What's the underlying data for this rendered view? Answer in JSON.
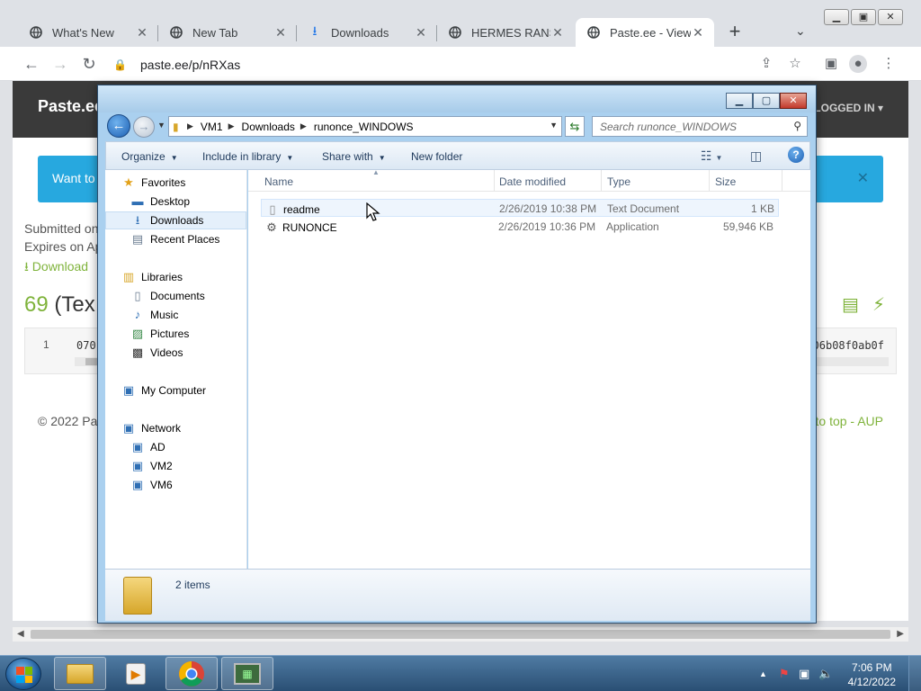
{
  "browser": {
    "tabs": [
      {
        "title": "What's New",
        "icon": "globe-icon"
      },
      {
        "title": "New Tab",
        "icon": "globe-icon"
      },
      {
        "title": "Downloads",
        "icon": "download-icon"
      },
      {
        "title": "HERMES RANSO",
        "icon": "globe-icon"
      },
      {
        "title": "Paste.ee - View p",
        "icon": "globe-icon",
        "active": true
      }
    ],
    "url": "paste.ee/p/nRXas"
  },
  "webpage": {
    "logo": "Paste.ee",
    "login": "T LOGGED IN",
    "banner": "Want to",
    "submitted": "Submitted on",
    "expires": "Expires on Ap",
    "download": "Download",
    "paste_num": "69",
    "paste_type": "(Tex",
    "code_line_no": "1",
    "code_line": "070",
    "code_tail": "706b08f0ab0f",
    "footer_left": "© 2022 Pa",
    "footer_right": "to top - AUP"
  },
  "explorer": {
    "breadcrumb": [
      "VM1",
      "Downloads",
      "runonce_WINDOWS"
    ],
    "search_placeholder": "Search runonce_WINDOWS",
    "commands": {
      "organize": "Organize",
      "include": "Include in library",
      "share": "Share with",
      "new_folder": "New folder"
    },
    "nav": {
      "favorites": "Favorites",
      "desktop": "Desktop",
      "downloads": "Downloads",
      "recent": "Recent Places",
      "libraries": "Libraries",
      "documents": "Documents",
      "music": "Music",
      "pictures": "Pictures",
      "videos": "Videos",
      "computer": "My Computer",
      "network": "Network",
      "hosts": [
        "AD",
        "VM2",
        "VM6"
      ]
    },
    "columns": {
      "name": "Name",
      "date": "Date modified",
      "type": "Type",
      "size": "Size"
    },
    "files": [
      {
        "name": "readme",
        "date": "2/26/2019 10:38 PM",
        "type": "Text Document",
        "size": "1 KB",
        "icon": "text-file-icon"
      },
      {
        "name": "RUNONCE",
        "date": "2/26/2019 10:36 PM",
        "type": "Application",
        "size": "59,946 KB",
        "icon": "application-icon"
      }
    ],
    "status": "2 items"
  },
  "taskbar": {
    "time": "7:06 PM",
    "date": "4/12/2022"
  }
}
